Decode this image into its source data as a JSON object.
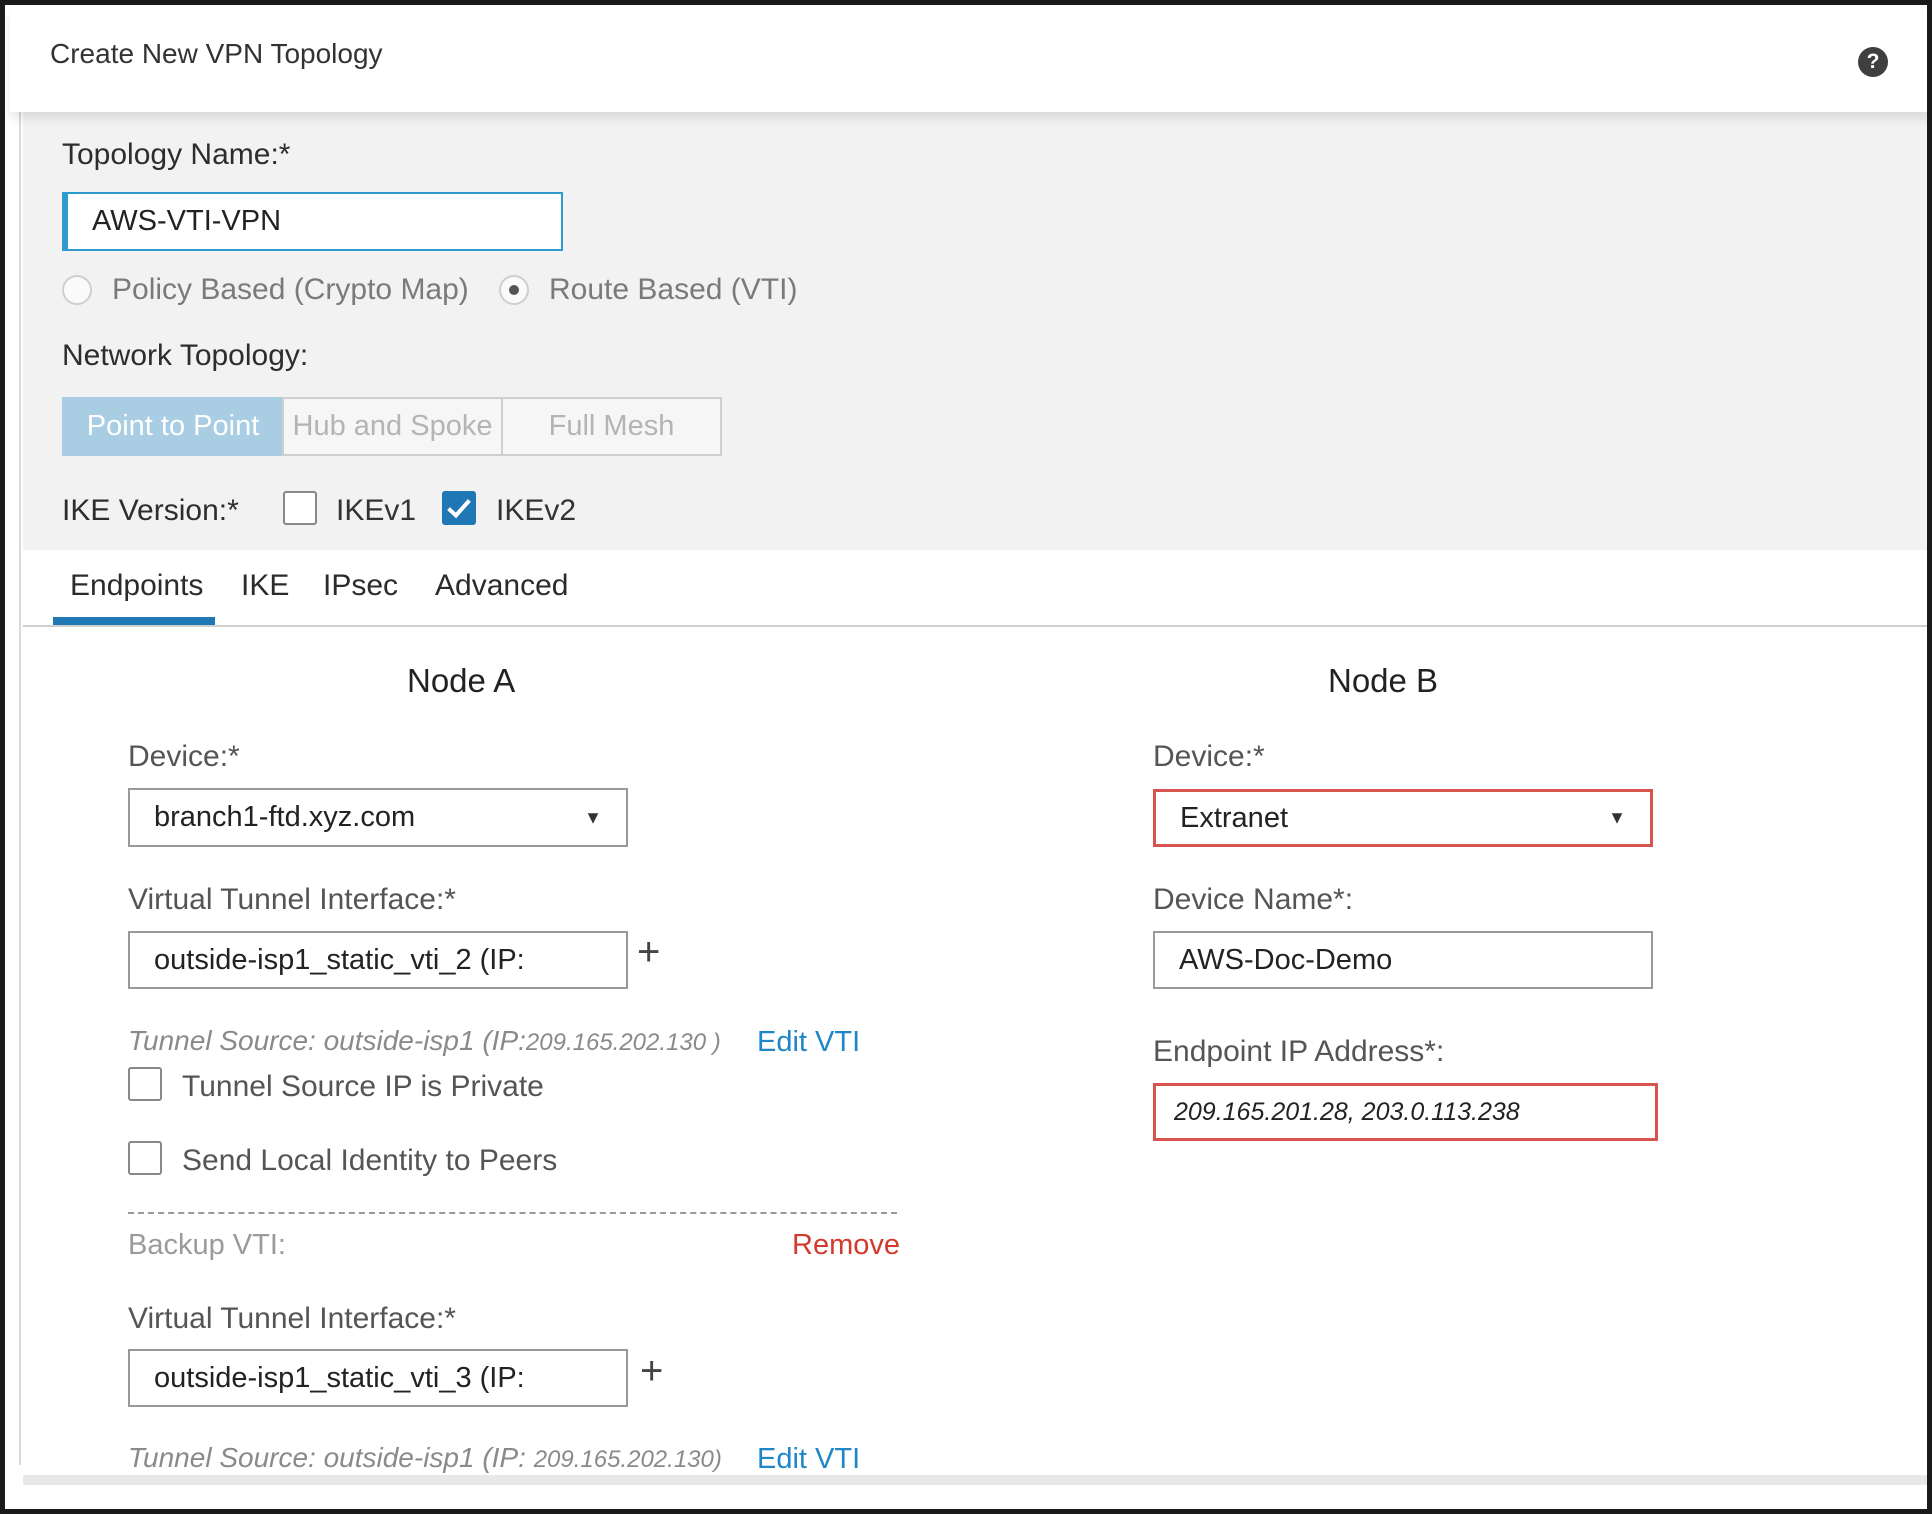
{
  "header": {
    "title": "Create New VPN Topology",
    "help_icon": "?"
  },
  "form": {
    "topology_name_label": "Topology Name:*",
    "topology_name_value": "AWS-VTI-VPN",
    "vpn_type_options": [
      {
        "label": "Policy Based (Crypto Map)",
        "selected": false
      },
      {
        "label": "Route Based (VTI)",
        "selected": true
      }
    ],
    "network_topology_label": "Network Topology:",
    "network_topology_options": [
      {
        "label": "Point to Point",
        "active": true
      },
      {
        "label": "Hub and Spoke",
        "active": false
      },
      {
        "label": "Full Mesh",
        "active": false
      }
    ],
    "ike_version_label": "IKE Version:*",
    "ike_options": [
      {
        "label": "IKEv1",
        "checked": false
      },
      {
        "label": "IKEv2",
        "checked": true
      }
    ]
  },
  "tabs": [
    "Endpoints",
    "IKE",
    "IPsec",
    "Advanced"
  ],
  "active_tab": "Endpoints",
  "node_a": {
    "title": "Node A",
    "device_label": "Device:*",
    "device_value": "branch1-ftd.xyz.com",
    "vti_label": "Virtual Tunnel Interface:*",
    "vti_value": "outside-isp1_static_vti_2 (IP:",
    "tunnel_source_prefix": "Tunnel Source: outside-isp1 (IP:",
    "tunnel_source_ip": "209.165.202.130 )",
    "edit_vti": "Edit VTI",
    "tunnel_private_label": "Tunnel Source IP is Private",
    "send_identity_label": "Send Local Identity to Peers",
    "backup_vti_label": "Backup VTI:",
    "remove_label": "Remove",
    "backup_vti_field_label": "Virtual Tunnel Interface:*",
    "backup_vti_value": "outside-isp1_static_vti_3 (IP:",
    "backup_source_prefix": "Tunnel Source: outside-isp1 (IP: ",
    "backup_source_ip": "209.165.202.130)",
    "backup_edit_vti": "Edit VTI"
  },
  "node_b": {
    "title": "Node B",
    "device_label": "Device:*",
    "device_value": "Extranet",
    "device_name_label": "Device Name*:",
    "device_name_value": "AWS-Doc-Demo",
    "endpoint_ip_label": "Endpoint IP Address*:",
    "endpoint_ip_value": "209.165.201.28, 203.0.113.238"
  },
  "colors": {
    "accent": "#1f78b4",
    "error": "#d9534f",
    "link": "#1f86c7",
    "remove": "#d33a2c"
  }
}
